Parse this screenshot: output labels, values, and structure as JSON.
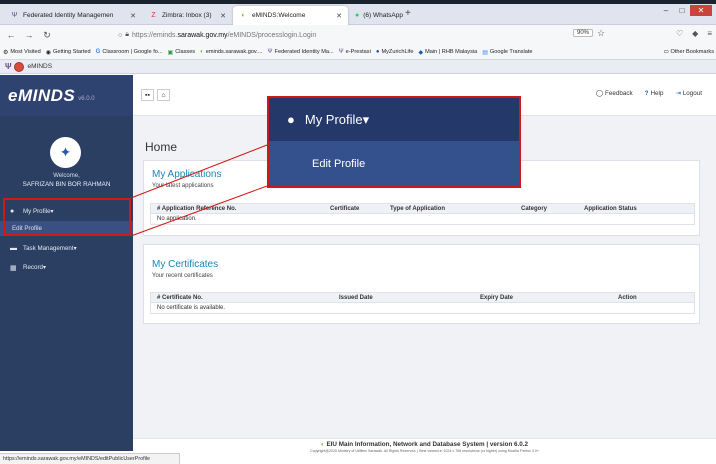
{
  "browser": {
    "tabs": [
      {
        "title": "Federated Identity Managemen",
        "icon": "fim-icon",
        "icon_color": "#6a4a8a"
      },
      {
        "title": "Zimbra: Inbox (3)",
        "icon": "zimbra-icon",
        "icon_color": "#d23b2e"
      },
      {
        "title": "eMINDS:Welcome",
        "icon": "eminds-icon",
        "icon_color": "#87b32a"
      },
      {
        "title": "(6) WhatsApp",
        "icon": "whatsapp-icon",
        "icon_color": "#25d366"
      }
    ],
    "url_prefix": "https://eminds.",
    "url_domain": "sarawak.gov.my",
    "url_path": "/eMINDS/processlogin.Login",
    "zoom": "90%",
    "bookmarks": [
      "Most Visited",
      "Getting Started",
      "Classroom | Google fo...",
      "Classes",
      "eminds.sarawak.gov....",
      "Federated Identity Ma...",
      "e-Prestasi",
      "MyZurichLife",
      "Main | RHB Malaysia",
      "Google Translate"
    ],
    "other_bookmarks": "Other Bookmarks",
    "app_tab_label": "eMINDS",
    "status_url": "https://eminds.sarawak.gov.my/eMINDS/editPublicUserProfile"
  },
  "app": {
    "brand": "eMINDS",
    "version": "v6.0.0",
    "welcome": "Welcome,",
    "user_name": "SAFRIZAN BIN BOR RAHMAN",
    "sidebar": {
      "my_profile": "My Profile",
      "edit_profile": "Edit Profile",
      "task_management": "Task Management",
      "record": "Record"
    },
    "topnav": {
      "feedback": "Feedback",
      "help": "Help",
      "logout": "Logout"
    },
    "home_title": "Home",
    "applications": {
      "title": "My Applications",
      "subtitle": "Your latest applications",
      "columns": [
        "# Application Reference No.",
        "Certificate",
        "Type of Application",
        "Category",
        "Application Status"
      ],
      "empty": "No application."
    },
    "certificates": {
      "title": "My Certificates",
      "subtitle": "Your recent certificates",
      "columns": [
        "# Certificate No.",
        "Issued Date",
        "Expiry Date",
        "Action"
      ],
      "empty": "No certificate is available."
    },
    "callout": {
      "my_profile": "My Profile",
      "edit_profile": "Edit Profile"
    },
    "footer": {
      "line1": "EIU Main Information, Network and Database System | version 6.0.2",
      "line2": "Copyright@2020 Ministry of Utilities Sarawak. All Rights Reserved. | Best viewed in 1024 x 768 resolutions (or higher) using Mozilla Firefox 3.0+"
    }
  },
  "colors": {
    "sidebar": "#2b3f63",
    "accent": "#1a86b5",
    "highlight": "#d01818"
  }
}
